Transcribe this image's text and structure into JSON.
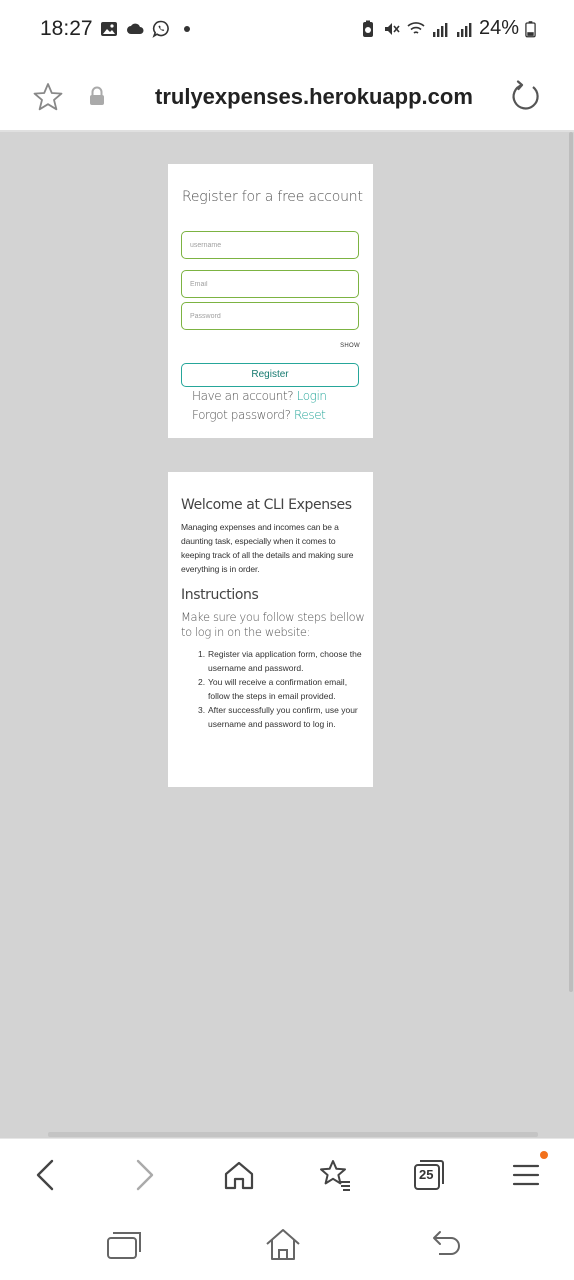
{
  "status_bar": {
    "time": "18:27",
    "battery": "24%",
    "left_icons": [
      "gallery-icon",
      "cloud-icon",
      "viber-icon",
      "dot-icon"
    ],
    "right_icons": [
      "battery-saver-icon",
      "mute-icon",
      "wifi-icon",
      "signal-r-icon",
      "signal-icon"
    ]
  },
  "url_bar": {
    "url": "trulyexpenses.herokuapp.com"
  },
  "register": {
    "title": "Register for a free account",
    "username_placeholder": "username",
    "email_placeholder": "Email",
    "password_placeholder": "Password",
    "show_label": "SHOW",
    "register_button": "Register",
    "have_account_text": "Have an account? ",
    "login_link": "Login",
    "forgot_text": "Forgot password? ",
    "reset_link": "Reset"
  },
  "welcome": {
    "title": "Welcome at CLI Expenses",
    "paragraph": "Managing expenses and incomes can be a daunting task, especially when it comes to keeping track of all the details and making sure everything is in order.",
    "instructions_title": "Instructions",
    "instructions_intro": "Make sure you follow steps bellow to log in on the website:",
    "steps": [
      {
        "num": "1.",
        "text": "Register via application form, choose the username and password."
      },
      {
        "num": "2.",
        "text": "You will receive a confirmation email, follow the steps in email provided."
      },
      {
        "num": "3.",
        "text": "After successfully you confirm, use your username and password to log in."
      }
    ]
  },
  "toolbar": {
    "tab_count": "25",
    "accent": "#f2711c"
  },
  "colors": {
    "link": "#26a69a",
    "field_border": "#7cb342",
    "page_bg": "#d3d3d3"
  }
}
